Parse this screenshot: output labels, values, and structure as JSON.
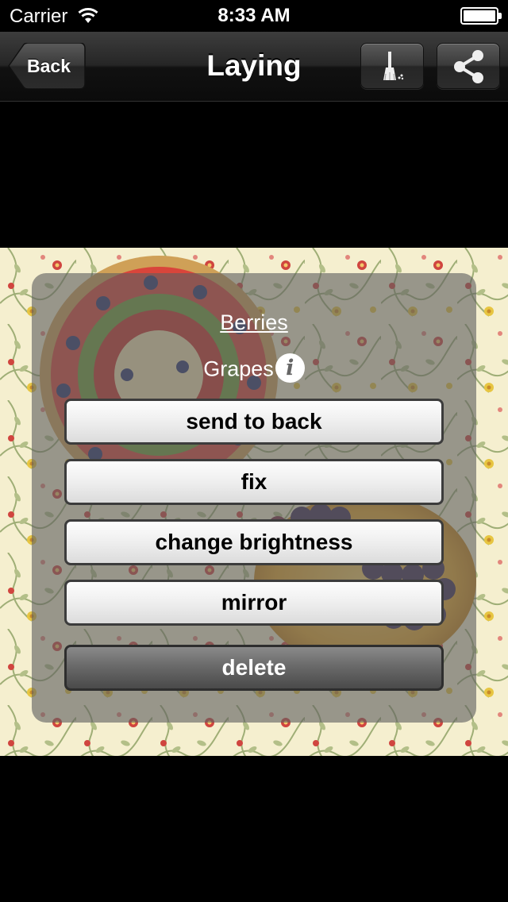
{
  "status_bar": {
    "carrier": "Carrier",
    "time": "8:33 AM"
  },
  "nav_bar": {
    "back_label": "Back",
    "title": "Laying",
    "clean_icon": "broom-icon",
    "share_icon": "share-icon"
  },
  "popup": {
    "layers": [
      {
        "label": "Berries",
        "selected": true
      },
      {
        "label": "Grapes",
        "info_icon": "info-icon"
      }
    ],
    "actions": [
      {
        "label": "send to back"
      },
      {
        "label": "fix"
      },
      {
        "label": "change brightness"
      },
      {
        "label": "mirror"
      },
      {
        "label": "delete",
        "style": "destructive"
      }
    ]
  },
  "colors": {
    "wallpaper": "#f5efcf",
    "nav_bar": "#262626",
    "popup_overlay": "#5f5f5f",
    "button_light": "#f0f0f0",
    "button_dark": "#6a6a6a"
  }
}
